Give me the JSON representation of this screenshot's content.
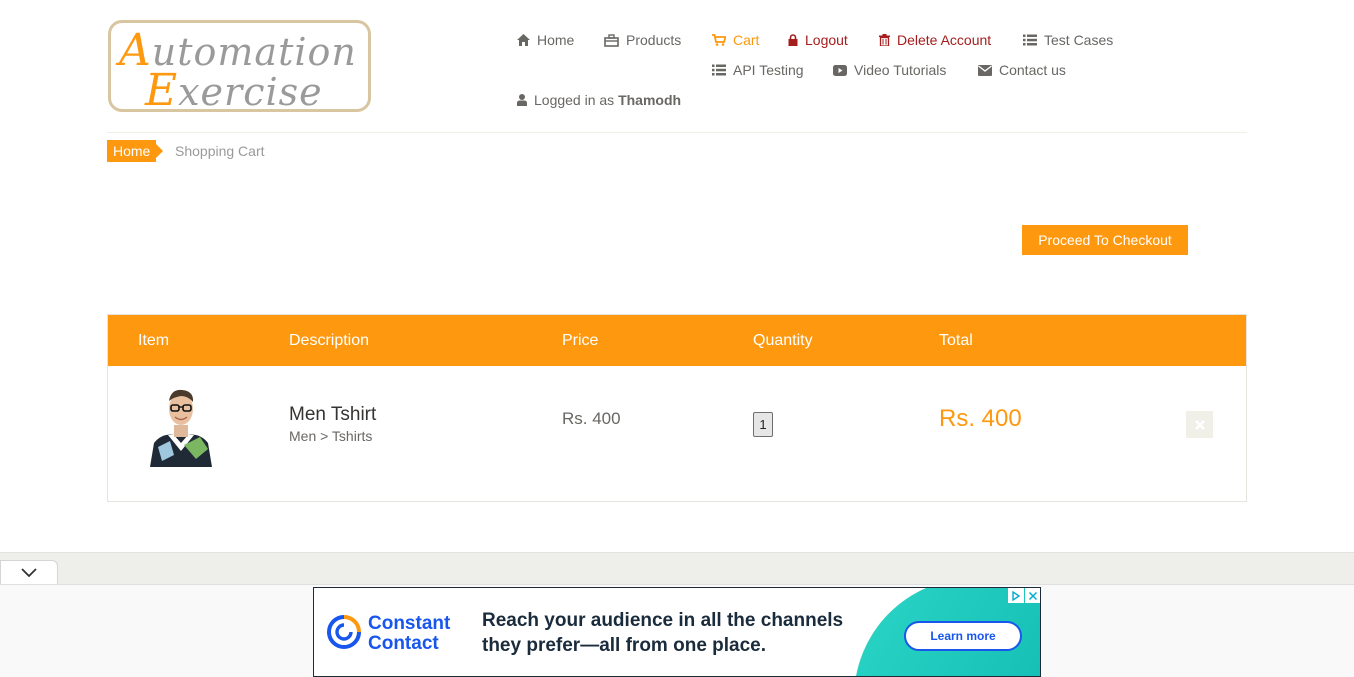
{
  "logo": {
    "line1": "Automation",
    "line2": "Exercise"
  },
  "nav": {
    "home": "Home",
    "products": "Products",
    "cart": "Cart",
    "logout": "Logout",
    "delete_account": "Delete Account",
    "test_cases": "Test Cases",
    "api_testing": "API Testing",
    "video_tutorials": "Video Tutorials",
    "contact_us": "Contact us",
    "logged_in_prefix": "Logged in as",
    "username": "Thamodh"
  },
  "breadcrumb": {
    "home": "Home",
    "current": "Shopping Cart"
  },
  "checkout_button": "Proceed To Checkout",
  "table": {
    "headers": {
      "item": "Item",
      "description": "Description",
      "price": "Price",
      "quantity": "Quantity",
      "total": "Total"
    },
    "rows": [
      {
        "name": "Men Tshirt",
        "category": "Men > Tshirts",
        "price": "Rs. 400",
        "quantity": "1",
        "total": "Rs. 400"
      }
    ]
  },
  "ad": {
    "brand_line1": "Constant",
    "brand_line2": "Contact",
    "text_line1": "Reach your audience in all the channels",
    "text_line2": "they prefer—all from one place.",
    "button": "Learn more"
  },
  "colors": {
    "accent": "#fe980f",
    "danger": "#a51d1d",
    "text": "#696763",
    "ad_blue": "#1856ed"
  }
}
